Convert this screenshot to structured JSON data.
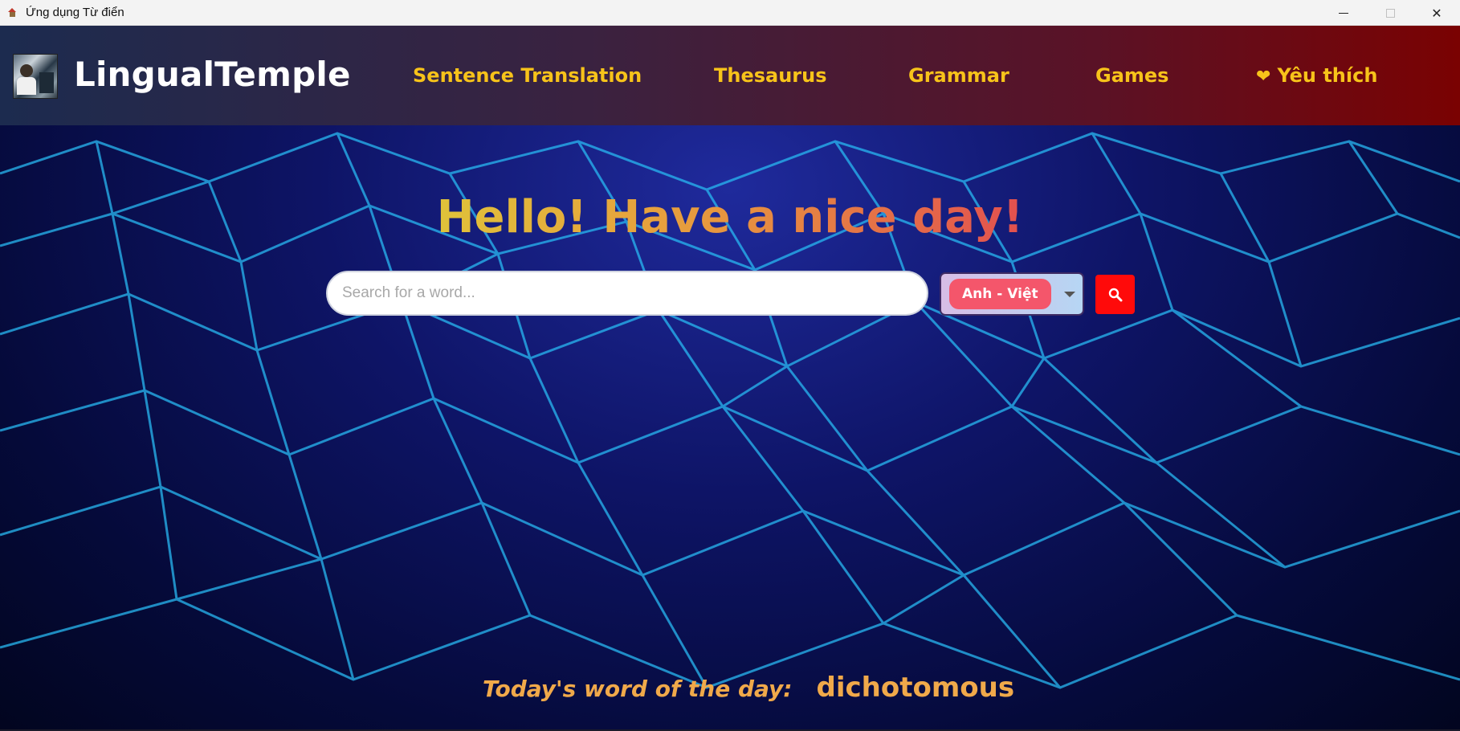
{
  "window": {
    "title": "Ứng dụng Từ điển",
    "controls": {
      "minimize": "minimize",
      "maximize": "maximize",
      "close": "✕"
    }
  },
  "header": {
    "brand": "LingualTemple",
    "nav": {
      "translation": "Sentence Translation",
      "thesaurus": "Thesaurus",
      "grammar": "Grammar",
      "games": "Games",
      "favorites": "Yêu thích",
      "favorites_icon": "❤"
    }
  },
  "main": {
    "greeting": "Hello! Have a nice day!",
    "search": {
      "placeholder": "Search for a word...",
      "value": ""
    },
    "language": {
      "selected": "Anh - Việt"
    },
    "word_of_day": {
      "label": "Today's word of the day:",
      "word": "dichotomous"
    }
  },
  "colors": {
    "nav_text": "#f7c31a",
    "search_button": "#ff0a0a",
    "language_pill": "#f4566b",
    "word_of_day": "#f0a94a"
  },
  "icons": {
    "app": "dictionary-app-icon",
    "search": "search-icon",
    "dropdown": "chevron-down-icon",
    "favorite": "heart-icon"
  }
}
